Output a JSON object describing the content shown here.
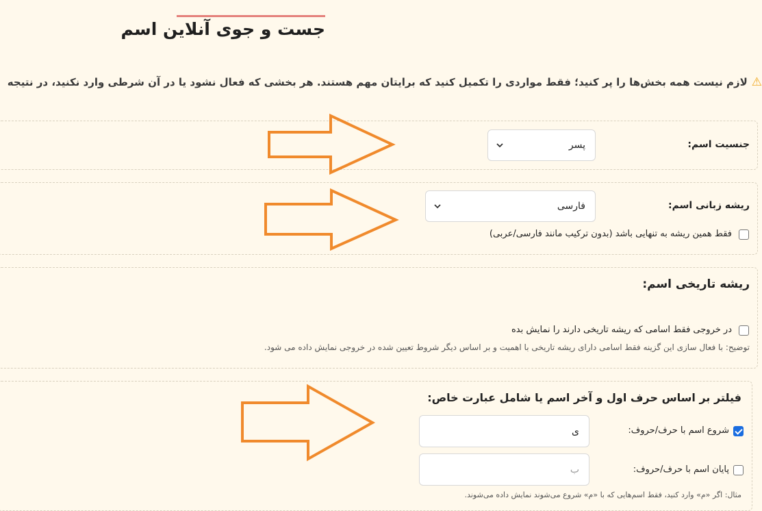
{
  "page": {
    "title": "جست و جوی آنلاین اسم",
    "notice": "لازم نیست همه بخش‌ها را پر کنید؛ فقط مواردی را تکمیل کنید که برایتان مهم هستند. هر بخشی که فعال نشود یا در آن شرطی وارد نکنید، در نتیجه",
    "notice_icon": "warning-icon"
  },
  "gender": {
    "label": "جنسیت اسم:",
    "selected": "پسر"
  },
  "language_root": {
    "label": "ریشه زبانی اسم:",
    "selected": "فارسی",
    "only_root_label": "فقط همین ریشه به تنهایی باشد (بدون ترکیب مانند فارسی/عربی)"
  },
  "historical_root": {
    "heading": "ریشه تاریخی اسم:",
    "checkbox_label": "در خروجی فقط اسامی که ریشه تاریخی دارند را نمایش بده",
    "description": "توضیح: با فعال سازی این گزینه فقط اسامی دارای ریشه تاریخی با اهمیت و بر اساس دیگر شروط تعیین شده در خروجی نمایش داده می شود."
  },
  "letter_filter": {
    "heading": "فیلتر بر اساس حرف اول و آخر اسم یا شامل عبارت خاص:",
    "start_label": "شروع اسم با حرف/حروف:",
    "start_value": "ی",
    "end_label": "پایان اسم با حرف/حروف:",
    "end_placeholder": "ب",
    "example": "مثال: اگر «م» وارد کنید، فقط اسم‌هایی که با «م» شروع می‌شوند نمایش داده می‌شوند."
  },
  "colors": {
    "background": "#fff9ec",
    "accent_line": "#e4807a",
    "arrow": "#f08a2c",
    "checkbox_checked": "#1a6de0"
  }
}
